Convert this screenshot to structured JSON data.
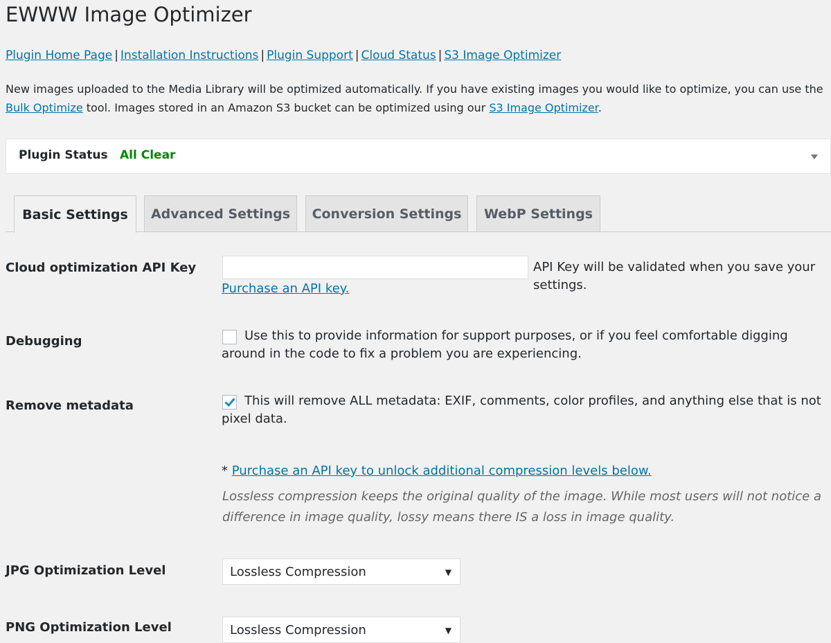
{
  "page": {
    "title": "EWWW Image Optimizer"
  },
  "links": [
    "Plugin Home Page",
    "Installation Instructions",
    "Plugin Support",
    "Cloud Status",
    "S3 Image Optimizer"
  ],
  "link_separator": "|",
  "intro": {
    "text1": "New images uploaded to the Media Library will be optimized automatically. If you have existing images you would like to optimize, you can use the ",
    "bulk_link": "Bulk Optimize",
    "text2": " tool. Images stored in an Amazon S3 bucket can be optimized using our ",
    "s3_link": "S3 Image Optimizer",
    "text3": "."
  },
  "plugin_status": {
    "label": "Plugin Status",
    "value": "All Clear",
    "toggle_icon": "triangle-down"
  },
  "tabs": [
    {
      "label": "Basic Settings",
      "active": true
    },
    {
      "label": "Advanced Settings",
      "active": false
    },
    {
      "label": "Conversion Settings",
      "active": false
    },
    {
      "label": "WebP Settings",
      "active": false
    }
  ],
  "settings": {
    "api_key": {
      "label": "Cloud optimization API Key",
      "value": "",
      "help1": "API Key will be validated when you save your settings. ",
      "help_link": "Purchase an API key."
    },
    "debugging": {
      "label": "Debugging",
      "checked": false,
      "description": "Use this to provide information for support purposes, or if you feel comfortable digging around in the code to fix a problem you are experiencing."
    },
    "remove_metadata": {
      "label": "Remove metadata",
      "checked": true,
      "description": "This will remove ALL metadata: EXIF, comments, color profiles, and anything else that is not pixel data."
    },
    "compression_note": {
      "asterisk": "* ",
      "link": "Purchase an API key to unlock additional compression levels below.",
      "italic": "Lossless compression keeps the original quality of the image. While most users will not notice a difference in image quality, lossy means there IS a loss in image quality."
    },
    "jpg_level": {
      "label": "JPG Optimization Level",
      "selected": "Lossless Compression"
    },
    "png_level": {
      "label": "PNG Optimization Level",
      "selected": "Lossless Compression"
    }
  },
  "colors": {
    "link": "#0073aa",
    "status_ok": "#008a00",
    "background": "#f1f1f1"
  }
}
